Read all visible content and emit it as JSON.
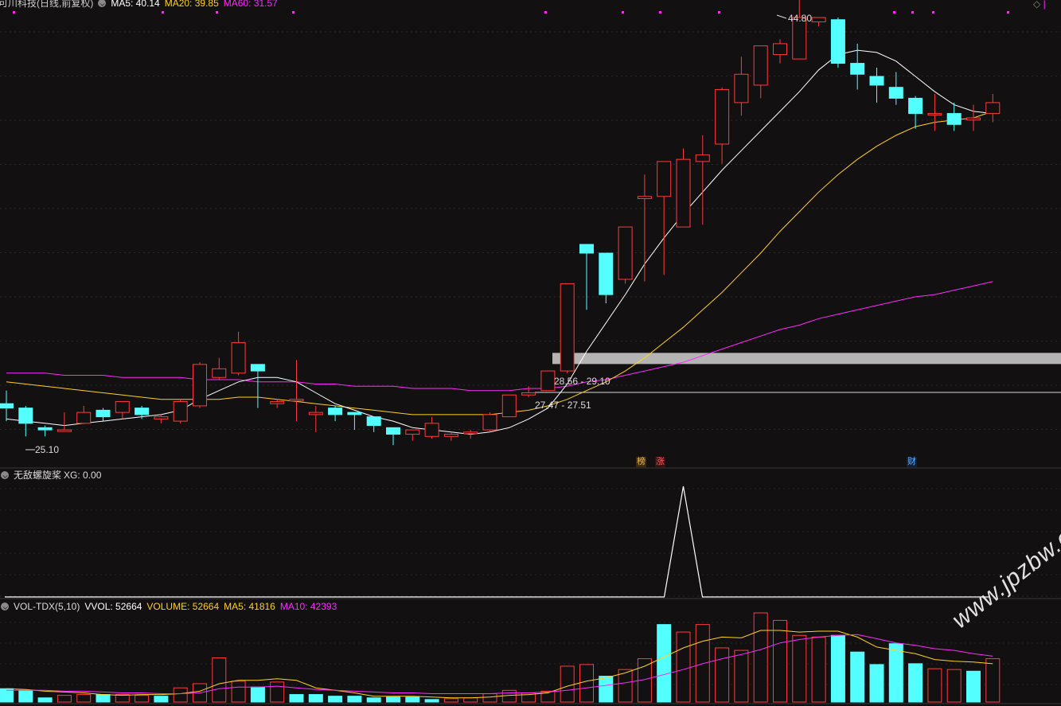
{
  "header": {
    "title": "可川科技(日线,前复权)",
    "ma5": "MA5: 40.14",
    "ma20": "MA20: 39.85",
    "ma60": "MA60: 31.57"
  },
  "indicator": {
    "name": "无敌螺旋桨",
    "xg": "XG: 0.00"
  },
  "volume_header": {
    "name": "VOL-TDX(5,10)",
    "vvol": "VVOL: 52664",
    "volume": "VOLUME: 52664",
    "ma5": "MA5: 41816",
    "ma10": "MA10: 42393"
  },
  "annotations": {
    "high_label": "44.80",
    "low_label": "25.10",
    "zone_upper": "28.56 - 29.10",
    "zone_lower": "27.47 - 27.51",
    "tag_bang": "榜",
    "tag_zhang": "涨",
    "tag_cai": "财"
  },
  "watermark": "www.jpzbw.cn",
  "colors": {
    "up": "#ff3b3b",
    "down": "#54ffff",
    "ma5": "#ffffff",
    "ma20": "#ffd21f",
    "ma60": "#ff2bff"
  },
  "chart_data": {
    "type": "candlestick",
    "candles": [
      [
        27.1,
        27.7,
        26.9,
        26.3
      ],
      [
        26.9,
        27.0,
        26.2,
        25.6
      ],
      [
        26.0,
        26.1,
        25.9,
        25.6
      ],
      [
        25.9,
        26.7,
        25.9,
        26.1
      ],
      [
        26.2,
        27.0,
        26.7,
        26.2
      ],
      [
        26.8,
        26.9,
        26.5,
        26.3
      ],
      [
        26.7,
        27.1,
        27.2,
        26.4
      ],
      [
        26.9,
        27.0,
        26.6,
        26.4
      ],
      [
        26.4,
        26.6,
        26.5,
        26.2
      ],
      [
        26.3,
        27.3,
        27.2,
        26.2
      ],
      [
        27.0,
        29.0,
        28.9,
        26.9
      ],
      [
        28.3,
        29.2,
        28.7,
        28.2
      ],
      [
        28.5,
        30.4,
        29.9,
        28.4
      ],
      [
        28.9,
        28.5,
        28.6,
        26.9
      ],
      [
        27.1,
        27.3,
        27.2,
        26.9
      ],
      [
        27.3,
        29.1,
        27.3,
        26.3
      ],
      [
        26.6,
        27.0,
        26.7,
        25.8
      ],
      [
        26.9,
        27.0,
        26.6,
        26.3
      ],
      [
        26.7,
        26.5,
        26.6,
        25.9
      ],
      [
        26.5,
        26.0,
        26.1,
        25.8
      ],
      [
        26.0,
        25.7,
        25.7,
        25.2
      ],
      [
        25.7,
        25.9,
        25.9,
        25.4
      ],
      [
        25.6,
        26.5,
        26.2,
        25.5
      ],
      [
        25.6,
        25.8,
        25.7,
        25.4
      ],
      [
        25.8,
        25.9,
        25.8,
        25.5
      ],
      [
        25.9,
        26.7,
        26.6,
        25.8
      ],
      [
        26.5,
        27.5,
        27.5,
        26.5
      ],
      [
        27.5,
        27.9,
        27.6,
        27.4
      ],
      [
        27.7,
        28.5,
        28.6,
        27.7
      ],
      [
        28.6,
        32.4,
        32.6,
        28.5
      ],
      [
        34.4,
        34.1,
        34.0,
        31.4
      ],
      [
        34.0,
        32.8,
        32.1,
        31.7
      ],
      [
        32.8,
        35.1,
        35.2,
        32.6
      ],
      [
        36.5,
        37.6,
        36.6,
        32.7
      ],
      [
        36.6,
        38.1,
        38.2,
        33.0
      ],
      [
        35.2,
        38.8,
        38.3,
        35.2
      ],
      [
        38.2,
        39.4,
        38.5,
        35.3
      ],
      [
        39.0,
        41.6,
        41.5,
        38.1
      ],
      [
        40.9,
        43.0,
        42.2,
        40.3
      ],
      [
        41.7,
        42.9,
        43.5,
        41.1
      ],
      [
        43.1,
        43.8,
        43.6,
        42.7
      ],
      [
        42.9,
        45.8,
        44.8,
        42.9
      ],
      [
        44.6,
        44.8,
        44.8,
        44.4
      ],
      [
        44.7,
        44.8,
        42.7,
        42.5
      ],
      [
        42.7,
        43.6,
        42.2,
        41.5
      ],
      [
        42.1,
        42.5,
        41.7,
        40.9
      ],
      [
        41.6,
        42.3,
        41.1,
        40.8
      ],
      [
        41.1,
        41.2,
        40.4,
        39.7
      ],
      [
        40.4,
        41.3,
        40.4,
        39.6
      ],
      [
        40.4,
        40.9,
        39.9,
        39.6
      ],
      [
        40.1,
        40.8,
        40.2,
        39.6
      ],
      [
        40.4,
        41.3,
        40.9,
        40.0
      ]
    ],
    "ma5": [
      26.4,
      26.3,
      26.2,
      26.1,
      26.2,
      26.3,
      26.4,
      26.5,
      26.6,
      26.8,
      27.3,
      27.7,
      28.1,
      28.3,
      28.3,
      28.1,
      27.6,
      27.1,
      26.8,
      26.5,
      26.3,
      26.0,
      25.9,
      25.8,
      25.7,
      25.8,
      26.0,
      26.4,
      26.9,
      28.0,
      29.5,
      30.8,
      32.1,
      33.5,
      34.7,
      35.8,
      36.8,
      37.8,
      38.7,
      39.6,
      40.5,
      41.4,
      42.4,
      43.1,
      43.3,
      43.2,
      42.8,
      42.1,
      41.4,
      40.8,
      40.5,
      40.4
    ],
    "ma20": [
      28.1,
      28.0,
      27.9,
      27.8,
      27.7,
      27.6,
      27.5,
      27.4,
      27.3,
      27.3,
      27.3,
      27.3,
      27.4,
      27.4,
      27.3,
      27.2,
      27.1,
      27.0,
      26.9,
      26.8,
      26.7,
      26.6,
      26.6,
      26.6,
      26.6,
      26.6,
      26.7,
      26.8,
      27.0,
      27.3,
      27.7,
      28.1,
      28.6,
      29.2,
      29.9,
      30.6,
      31.4,
      32.2,
      33.1,
      34.0,
      35.0,
      35.9,
      36.8,
      37.6,
      38.3,
      38.9,
      39.4,
      39.8,
      40.0,
      40.1,
      40.2,
      40.5
    ],
    "ma60": [
      28.5,
      28.5,
      28.5,
      28.4,
      28.4,
      28.4,
      28.3,
      28.3,
      28.3,
      28.3,
      28.2,
      28.2,
      28.2,
      28.1,
      28.1,
      28.1,
      28.0,
      28.0,
      27.9,
      27.9,
      27.9,
      27.8,
      27.8,
      27.8,
      27.7,
      27.7,
      27.7,
      27.8,
      27.8,
      27.9,
      28.1,
      28.2,
      28.4,
      28.6,
      28.8,
      29.0,
      29.3,
      29.6,
      29.9,
      30.2,
      30.5,
      30.7,
      31.0,
      31.2,
      31.4,
      31.6,
      31.8,
      32.0,
      32.1,
      32.3,
      32.5,
      32.7
    ],
    "xg_signal_index": 35,
    "volume": [
      16,
      14,
      5,
      8,
      9,
      9,
      9,
      8,
      7,
      17,
      22,
      53,
      25,
      18,
      24,
      9,
      9,
      7,
      7,
      5,
      6,
      6,
      3,
      4,
      5,
      10,
      14,
      11,
      13,
      43,
      45,
      31,
      39,
      52,
      93,
      84,
      93,
      65,
      62,
      107,
      98,
      80,
      78,
      80,
      60,
      45,
      70,
      46,
      40,
      39,
      37,
      52
    ],
    "volume_dir": [
      "down",
      "down",
      "down",
      "up",
      "up",
      "down",
      "up",
      "up",
      "down",
      "up",
      "up",
      "up",
      "up",
      "down",
      "up",
      "down",
      "down",
      "down",
      "down",
      "down",
      "down",
      "down",
      "down",
      "up",
      "up",
      "up",
      "up",
      "up",
      "up",
      "up",
      "up",
      "down",
      "up",
      "up",
      "down",
      "up",
      "up",
      "up",
      "up",
      "up",
      "up",
      "up",
      "up",
      "down",
      "down",
      "down",
      "down",
      "down",
      "up",
      "up",
      "down",
      "up"
    ],
    "vol_ma5": [
      16,
      15,
      13,
      12,
      11,
      9,
      8,
      9,
      9,
      10,
      13,
      22,
      26,
      26,
      28,
      26,
      17,
      14,
      11,
      7,
      7,
      7,
      6,
      5,
      5,
      6,
      8,
      9,
      11,
      19,
      25,
      29,
      35,
      43,
      54,
      65,
      73,
      78,
      77,
      86,
      86,
      84,
      85,
      85,
      78,
      66,
      62,
      58,
      51,
      49,
      48,
      46
    ],
    "vol_ma10": [
      14,
      14,
      14,
      13,
      13,
      12,
      11,
      11,
      10,
      10,
      11,
      16,
      18,
      18,
      19,
      17,
      15,
      14,
      13,
      12,
      11,
      11,
      10,
      10,
      10,
      10,
      11,
      11,
      12,
      14,
      17,
      20,
      23,
      27,
      33,
      39,
      46,
      52,
      57,
      63,
      71,
      75,
      78,
      80,
      81,
      76,
      71,
      68,
      64,
      62,
      58,
      55
    ],
    "price_levels": {
      "high": 44.8,
      "low": 25.1,
      "zone_upper": [
        28.56,
        29.1
      ],
      "zone_lower": [
        27.47,
        27.51
      ]
    }
  }
}
